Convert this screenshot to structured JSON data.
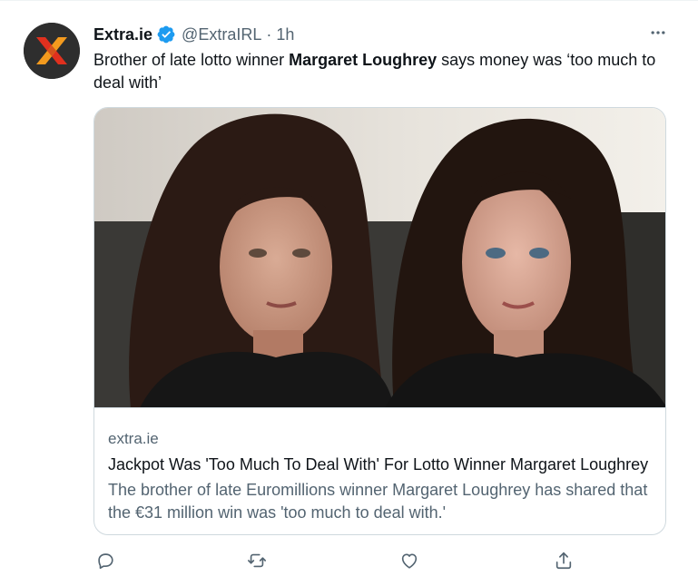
{
  "tweet": {
    "author": {
      "display_name": "Extra.ie",
      "handle": "@ExtraIRL",
      "verified": true,
      "avatar_icon": "extra-x-logo"
    },
    "separator": "·",
    "time": "1h",
    "more_icon": "more-horizontal-icon",
    "text_before": "Brother of late lotto winner ",
    "text_bold": "Margaret Loughrey",
    "text_after": " says money was ‘too much to deal with’",
    "card": {
      "domain": "extra.ie",
      "title": "Jackpot Was 'Too Much To Deal With' For Lotto Winner Margaret Loughrey",
      "description": "The brother of late Euromillions winner Margaret Loughrey has shared that the €31 million win was 'too much to deal with.'",
      "image_icon": "photo-two-women"
    },
    "actions": [
      "reply-icon",
      "retweet-icon",
      "like-icon",
      "share-icon"
    ]
  },
  "colors": {
    "text_primary": "#0f1419",
    "text_secondary": "#536471",
    "verified_blue": "#1d9bf0",
    "border": "#cfd9de",
    "logo_orange": "#f39a1e",
    "logo_red": "#e0301e"
  }
}
